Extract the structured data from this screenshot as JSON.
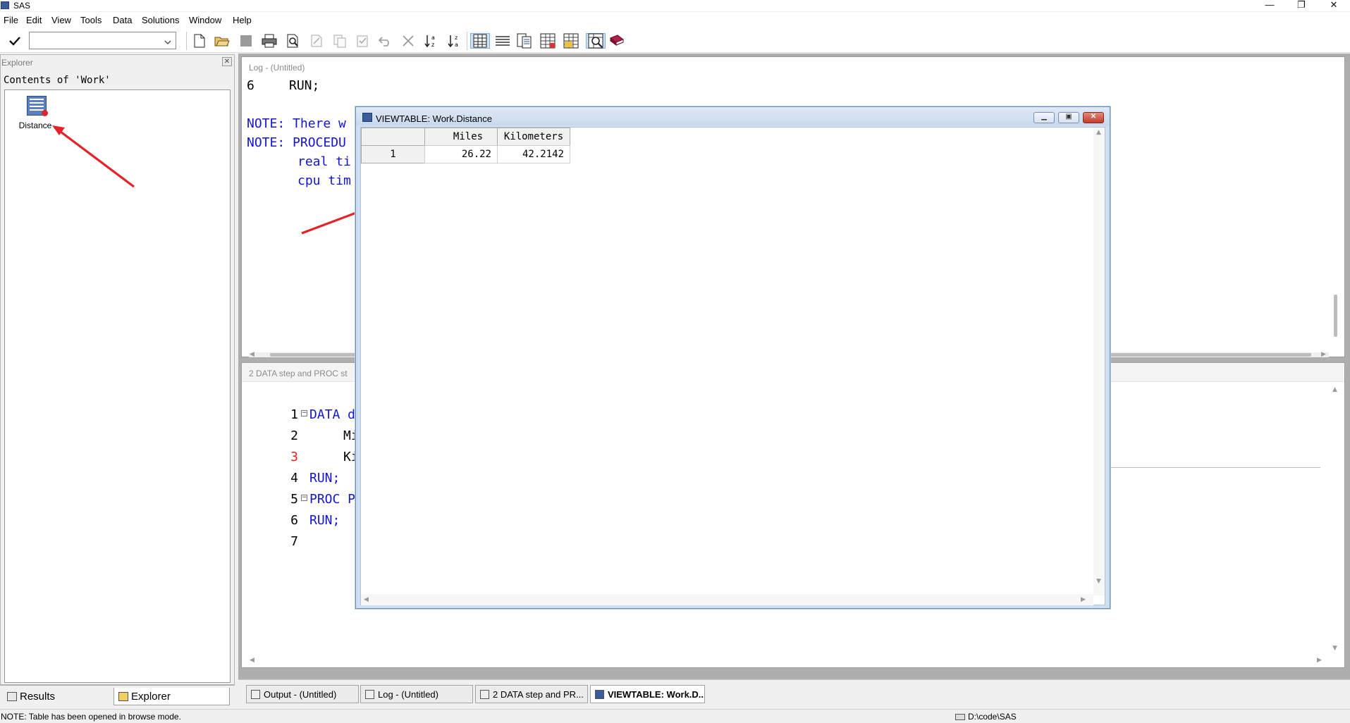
{
  "window": {
    "title": "SAS",
    "minimize": "—",
    "restore": "❐",
    "close": "✕"
  },
  "menu": [
    "File",
    "Edit",
    "View",
    "Tools",
    "Data",
    "Solutions",
    "Window",
    "Help"
  ],
  "toolbar": {
    "command_value": "",
    "icons": [
      "check-icon",
      "new-document-icon",
      "open-folder-icon",
      "save-icon",
      "print-icon",
      "print-preview-icon",
      "cut-icon",
      "copy-icon",
      "paste-icon",
      "undo-icon",
      "clear-icon",
      "sort-ascending-icon",
      "sort-descending-icon",
      "table-view-icon",
      "list-view-icon",
      "details-icon",
      "properties-icon",
      "query-icon",
      "find-icon",
      "help-book-icon"
    ]
  },
  "explorer": {
    "header": "Explorer",
    "contents_label": "Contents of 'Work'",
    "items": [
      {
        "label": "Distance"
      }
    ]
  },
  "explorer_tabs": {
    "results": "Results",
    "explorer": "Explorer"
  },
  "log": {
    "title": "Log - (Untitled)",
    "lines": [
      {
        "num": "6",
        "text": "RUN;"
      },
      {
        "text": "NOTE: There w"
      },
      {
        "text": "NOTE: PROCEDU"
      },
      {
        "text": "real ti"
      },
      {
        "text": "cpu tim"
      }
    ]
  },
  "editor": {
    "title": "2 DATA step and PROC st",
    "lines": [
      {
        "num": "1",
        "text": "DATA d",
        "fold": "−"
      },
      {
        "num": "2",
        "text": "Mi"
      },
      {
        "num": "3",
        "text": "Ki"
      },
      {
        "num": "4",
        "text": "RUN;"
      },
      {
        "num": "5",
        "text": "PROC P",
        "fold": "−"
      },
      {
        "num": "6",
        "text": "RUN;"
      },
      {
        "num": "7",
        "text": ""
      }
    ]
  },
  "viewtable": {
    "title": "VIEWTABLE: Work.Distance",
    "columns": [
      "Miles",
      "Kilometers"
    ],
    "rows": [
      {
        "row": "1",
        "miles": "26.22",
        "km": "42.2142"
      }
    ]
  },
  "window_tabs": [
    {
      "label": "Output - (Untitled)",
      "active": false
    },
    {
      "label": "Log - (Untitled)",
      "active": false
    },
    {
      "label": "2 DATA step and PR...",
      "active": false
    },
    {
      "label": "VIEWTABLE: Work.D...",
      "active": true
    }
  ],
  "status": {
    "message": "NOTE: Table has been opened in browse mode.",
    "path": "D:\\code\\SAS"
  },
  "colors": {
    "code_blue": "#1414d6",
    "line_red": "#e0201c",
    "arrow_red": "#e52228"
  }
}
